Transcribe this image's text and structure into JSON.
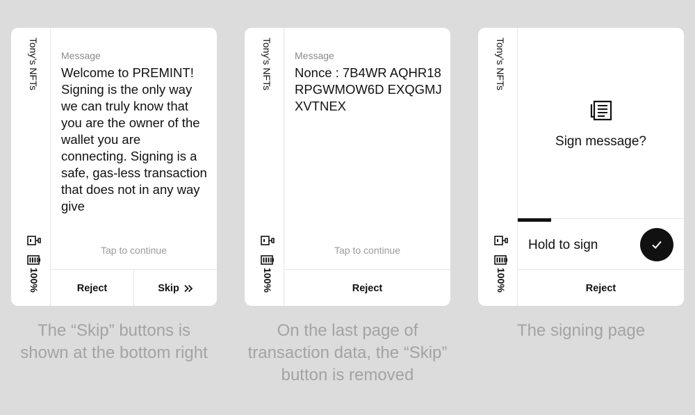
{
  "panels": [
    {
      "app_name": "Tony’s NFTs",
      "battery": "100%",
      "message_label": "Message",
      "message_body": "Welcome to PREMINT! Signing is the only way we can truly know that you are the owner of the wallet you are connecting. Signing is a safe, gas-less transaction that does not in any way give",
      "tap_hint": "Tap to continue",
      "reject_label": "Reject",
      "skip_label": "Skip",
      "caption": "The “Skip” buttons is shown at the bottom right"
    },
    {
      "app_name": "Tony’s NFTs",
      "battery": "100%",
      "message_label": "Message",
      "message_body": "Nonce : 7B4WR AQHR18RPGWMOW6D EXQGMJXVTNEX",
      "tap_hint": "Tap to continue",
      "reject_label": "Reject",
      "caption": "On the last page of transaction data, the “Skip” button is removed"
    },
    {
      "app_name": "Tony’s NFTs",
      "battery": "100%",
      "sign_title": "Sign message?",
      "hold_label": "Hold to sign",
      "hold_progress": 0.2,
      "reject_label": "Reject",
      "caption": "The signing page"
    }
  ],
  "icons": {
    "usb": "usb-connection-icon",
    "battery": "battery-icon",
    "document": "document-icon",
    "check": "checkmark-icon",
    "skip": "double-chevron-right-icon"
  },
  "colors": {
    "background": "#dcdcdc",
    "device": "#ffffff",
    "ink": "#111111",
    "muted": "#8a8a8a",
    "caption": "#a3a3a3"
  }
}
